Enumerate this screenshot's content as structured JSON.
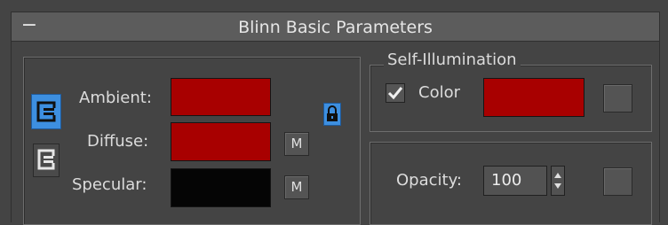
{
  "rollout": {
    "collapse_symbol": "−",
    "title": "Blinn Basic Parameters"
  },
  "colors": {
    "ambient": "#a80000",
    "diffuse": "#a80000",
    "specular": "#050505",
    "self_illum_color": "#a80000",
    "accent_active": "#3d8fe0"
  },
  "shading": {
    "ambient_label": "Ambient:",
    "diffuse_label": "Diffuse:",
    "specular_label": "Specular:",
    "map_button_label": "M",
    "lock_ambient_icon": "lock-active-icon",
    "lock_diffuse_icon": "lock-link-icon",
    "lock_specular_icon": "lock-link-icon"
  },
  "self_illumination": {
    "group_title": "Self-Illumination",
    "color_checkbox_label": "Color",
    "color_checked": true
  },
  "opacity": {
    "label": "Opacity:",
    "value": "100"
  }
}
